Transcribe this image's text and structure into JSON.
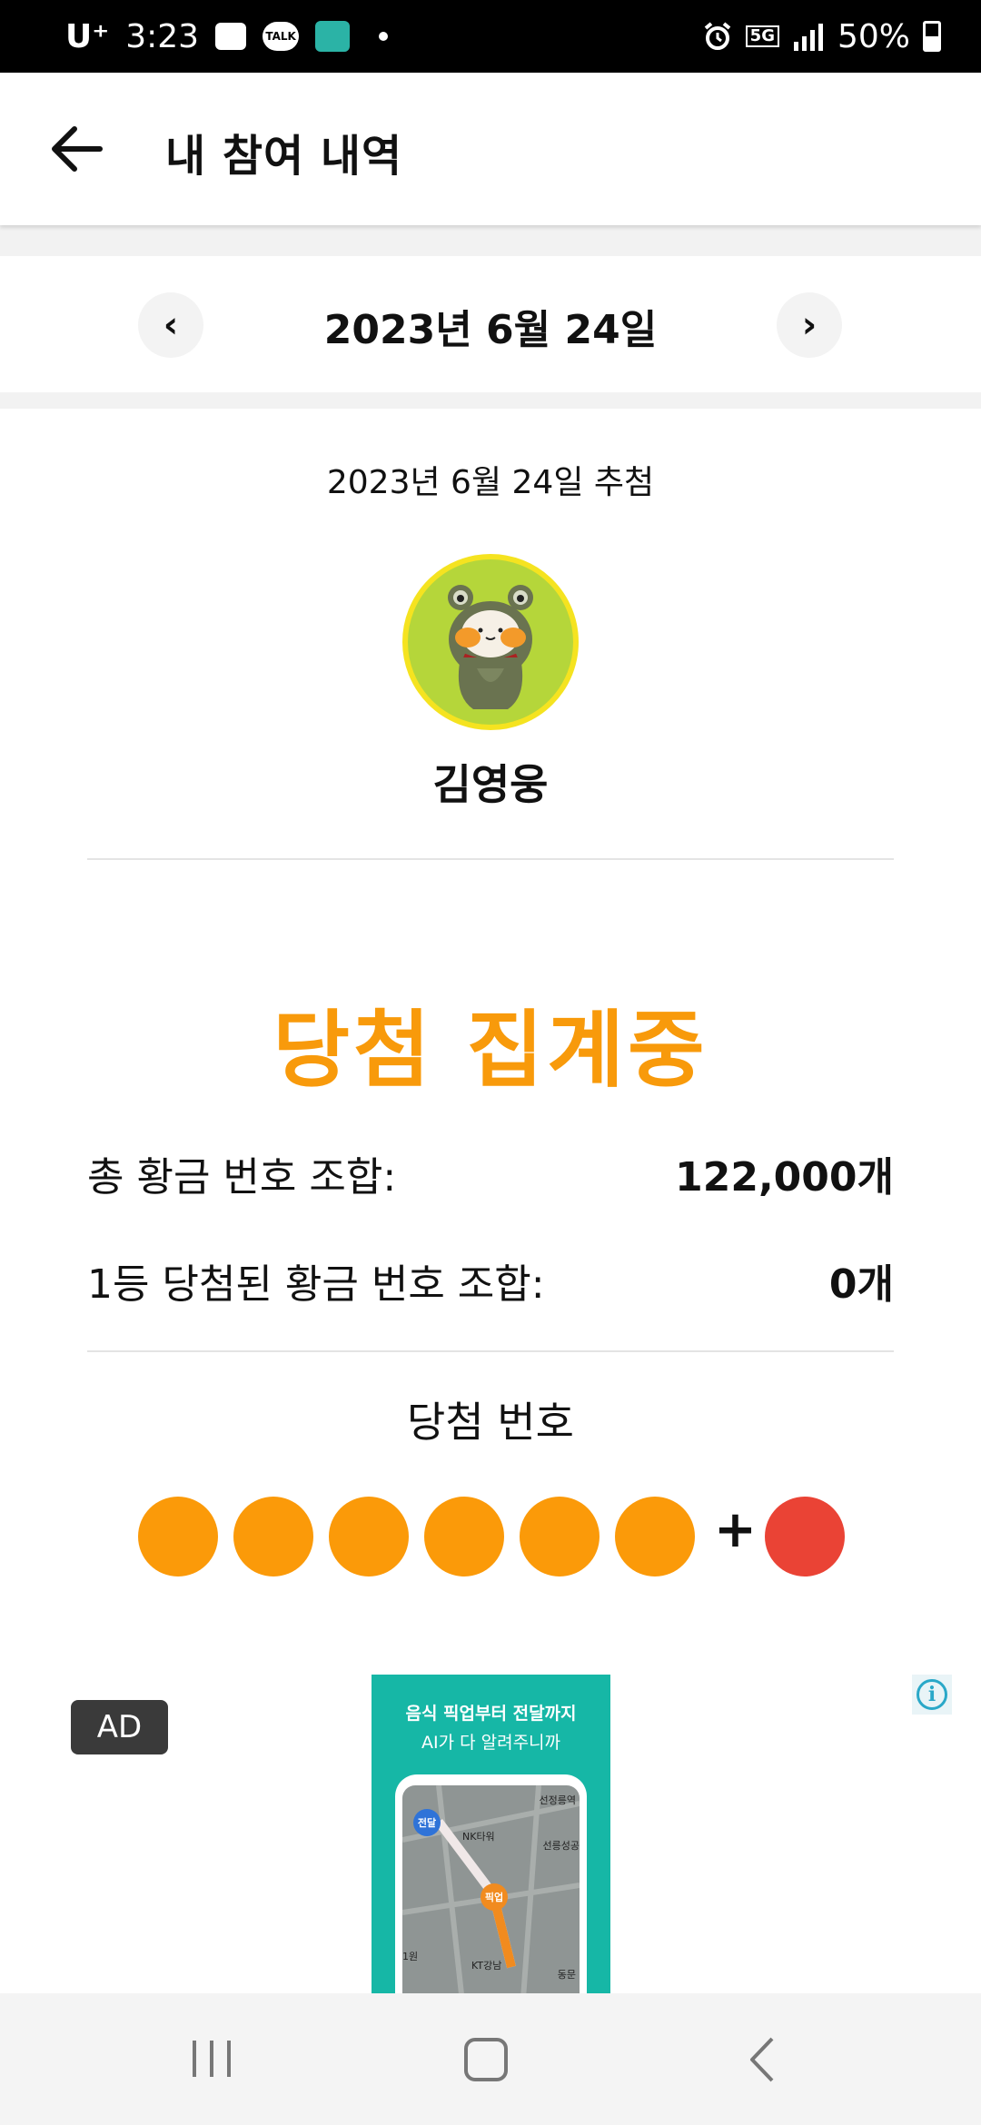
{
  "status_bar": {
    "carrier": "U⁺",
    "time": "3:23",
    "talk_icon_label": "TALK",
    "network": "5G",
    "battery": "50%"
  },
  "app_bar": {
    "title": "내 참여 내역"
  },
  "date_nav": {
    "prev": "‹",
    "next": "›",
    "date": "2023년 6월 24일"
  },
  "draw": {
    "draw_date": "2023년 6월 24일 추첨",
    "username": "김영웅",
    "status": "당첨 집계중",
    "rows": [
      {
        "label": "총 황금 번호 조합:",
        "value": "122,000개"
      },
      {
        "label": "1등 당첨된 황금 번호 조합:",
        "value": "0개"
      }
    ],
    "winning_numbers_title": "당첨 번호",
    "plus": "+"
  },
  "ad": {
    "badge": "AD",
    "info": "i",
    "headline_1": "음식 픽업부터 전달까지",
    "headline_2": "AI가 다 알려주니까",
    "pin_deliver": "전달",
    "pin_pickup": "픽업",
    "map_label_1": "선정릉역",
    "map_label_2": "NK타워",
    "map_label_3": "선릉성공",
    "map_label_4": "KT강남",
    "map_label_5": "동문",
    "map_label_6": "1원"
  },
  "colors": {
    "accent_orange": "#F89A0B",
    "ball_orange": "#FB9A09",
    "ball_red": "#EA4335",
    "avatar_bg": "#B5D63A",
    "avatar_ring": "#F5E320"
  }
}
